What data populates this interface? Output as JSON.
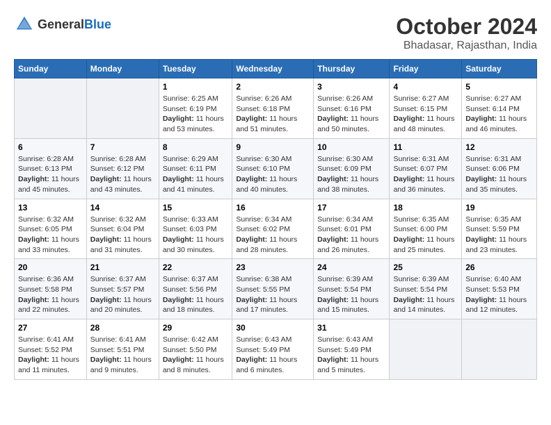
{
  "logo": {
    "general": "General",
    "blue": "Blue"
  },
  "title": "October 2024",
  "subtitle": "Bhadasar, Rajasthan, India",
  "headers": [
    "Sunday",
    "Monday",
    "Tuesday",
    "Wednesday",
    "Thursday",
    "Friday",
    "Saturday"
  ],
  "weeks": [
    [
      {
        "day": "",
        "info": ""
      },
      {
        "day": "",
        "info": ""
      },
      {
        "day": "1",
        "info": "Sunrise: 6:25 AM\nSunset: 6:19 PM\nDaylight: 11 hours and 53 minutes."
      },
      {
        "day": "2",
        "info": "Sunrise: 6:26 AM\nSunset: 6:18 PM\nDaylight: 11 hours and 51 minutes."
      },
      {
        "day": "3",
        "info": "Sunrise: 6:26 AM\nSunset: 6:16 PM\nDaylight: 11 hours and 50 minutes."
      },
      {
        "day": "4",
        "info": "Sunrise: 6:27 AM\nSunset: 6:15 PM\nDaylight: 11 hours and 48 minutes."
      },
      {
        "day": "5",
        "info": "Sunrise: 6:27 AM\nSunset: 6:14 PM\nDaylight: 11 hours and 46 minutes."
      }
    ],
    [
      {
        "day": "6",
        "info": "Sunrise: 6:28 AM\nSunset: 6:13 PM\nDaylight: 11 hours and 45 minutes."
      },
      {
        "day": "7",
        "info": "Sunrise: 6:28 AM\nSunset: 6:12 PM\nDaylight: 11 hours and 43 minutes."
      },
      {
        "day": "8",
        "info": "Sunrise: 6:29 AM\nSunset: 6:11 PM\nDaylight: 11 hours and 41 minutes."
      },
      {
        "day": "9",
        "info": "Sunrise: 6:30 AM\nSunset: 6:10 PM\nDaylight: 11 hours and 40 minutes."
      },
      {
        "day": "10",
        "info": "Sunrise: 6:30 AM\nSunset: 6:09 PM\nDaylight: 11 hours and 38 minutes."
      },
      {
        "day": "11",
        "info": "Sunrise: 6:31 AM\nSunset: 6:07 PM\nDaylight: 11 hours and 36 minutes."
      },
      {
        "day": "12",
        "info": "Sunrise: 6:31 AM\nSunset: 6:06 PM\nDaylight: 11 hours and 35 minutes."
      }
    ],
    [
      {
        "day": "13",
        "info": "Sunrise: 6:32 AM\nSunset: 6:05 PM\nDaylight: 11 hours and 33 minutes."
      },
      {
        "day": "14",
        "info": "Sunrise: 6:32 AM\nSunset: 6:04 PM\nDaylight: 11 hours and 31 minutes."
      },
      {
        "day": "15",
        "info": "Sunrise: 6:33 AM\nSunset: 6:03 PM\nDaylight: 11 hours and 30 minutes."
      },
      {
        "day": "16",
        "info": "Sunrise: 6:34 AM\nSunset: 6:02 PM\nDaylight: 11 hours and 28 minutes."
      },
      {
        "day": "17",
        "info": "Sunrise: 6:34 AM\nSunset: 6:01 PM\nDaylight: 11 hours and 26 minutes."
      },
      {
        "day": "18",
        "info": "Sunrise: 6:35 AM\nSunset: 6:00 PM\nDaylight: 11 hours and 25 minutes."
      },
      {
        "day": "19",
        "info": "Sunrise: 6:35 AM\nSunset: 5:59 PM\nDaylight: 11 hours and 23 minutes."
      }
    ],
    [
      {
        "day": "20",
        "info": "Sunrise: 6:36 AM\nSunset: 5:58 PM\nDaylight: 11 hours and 22 minutes."
      },
      {
        "day": "21",
        "info": "Sunrise: 6:37 AM\nSunset: 5:57 PM\nDaylight: 11 hours and 20 minutes."
      },
      {
        "day": "22",
        "info": "Sunrise: 6:37 AM\nSunset: 5:56 PM\nDaylight: 11 hours and 18 minutes."
      },
      {
        "day": "23",
        "info": "Sunrise: 6:38 AM\nSunset: 5:55 PM\nDaylight: 11 hours and 17 minutes."
      },
      {
        "day": "24",
        "info": "Sunrise: 6:39 AM\nSunset: 5:54 PM\nDaylight: 11 hours and 15 minutes."
      },
      {
        "day": "25",
        "info": "Sunrise: 6:39 AM\nSunset: 5:54 PM\nDaylight: 11 hours and 14 minutes."
      },
      {
        "day": "26",
        "info": "Sunrise: 6:40 AM\nSunset: 5:53 PM\nDaylight: 11 hours and 12 minutes."
      }
    ],
    [
      {
        "day": "27",
        "info": "Sunrise: 6:41 AM\nSunset: 5:52 PM\nDaylight: 11 hours and 11 minutes."
      },
      {
        "day": "28",
        "info": "Sunrise: 6:41 AM\nSunset: 5:51 PM\nDaylight: 11 hours and 9 minutes."
      },
      {
        "day": "29",
        "info": "Sunrise: 6:42 AM\nSunset: 5:50 PM\nDaylight: 11 hours and 8 minutes."
      },
      {
        "day": "30",
        "info": "Sunrise: 6:43 AM\nSunset: 5:49 PM\nDaylight: 11 hours and 6 minutes."
      },
      {
        "day": "31",
        "info": "Sunrise: 6:43 AM\nSunset: 5:49 PM\nDaylight: 11 hours and 5 minutes."
      },
      {
        "day": "",
        "info": ""
      },
      {
        "day": "",
        "info": ""
      }
    ]
  ]
}
